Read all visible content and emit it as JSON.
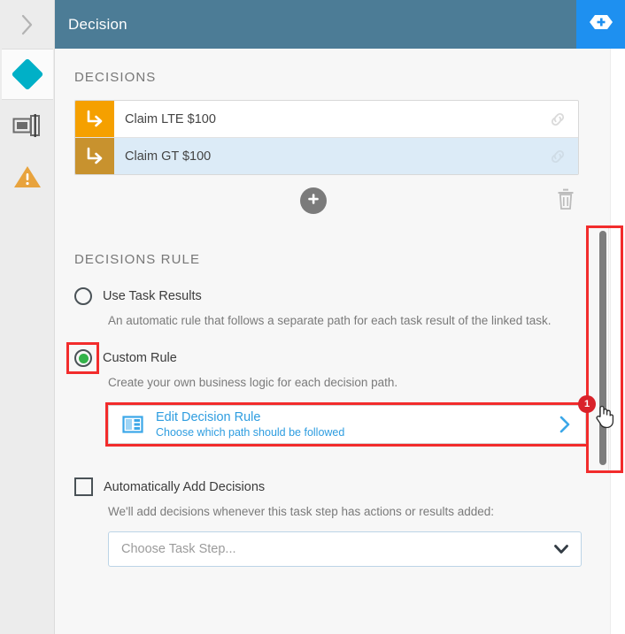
{
  "rail": {
    "expand_icon": "chevron-right-icon",
    "items": [
      {
        "id": "decision",
        "icon": "diamond-icon",
        "active": true
      },
      {
        "id": "form",
        "icon": "form-input-icon",
        "active": false
      },
      {
        "id": "warning",
        "icon": "warning-triangle-icon",
        "active": false
      }
    ]
  },
  "titlebar": {
    "title": "Decision",
    "add_button_icon": "add-hexagon-icon",
    "add_button_color": "#1e90f0",
    "background": "#4c7c96"
  },
  "decisions_section": {
    "heading": "DECISIONS",
    "rows": [
      {
        "label": "Claim LTE $100",
        "icon": "arrow-turn-right-icon",
        "link_icon": "chain-link-icon",
        "selected": false,
        "icon_color": "#f5a000"
      },
      {
        "label": "Claim GT $100",
        "icon": "arrow-turn-right-icon",
        "link_icon": "chain-link-icon",
        "selected": true,
        "icon_color": "#c8922e"
      }
    ],
    "add_icon": "plus-circle-icon",
    "delete_icon": "trash-icon"
  },
  "rule_section": {
    "heading": "DECISIONS RULE",
    "options": [
      {
        "label": "Use Task Results",
        "description": "An automatic rule that follows a separate path for each task result of the linked task.",
        "selected": false
      },
      {
        "label": "Custom Rule",
        "description": "Create your own business logic for each decision path.",
        "selected": true,
        "selected_color": "#33b34a"
      }
    ],
    "edit_rule": {
      "icon": "layout-panels-icon",
      "title": "Edit Decision Rule",
      "subtitle": "Choose which path should be followed",
      "chevron_icon": "chevron-right-icon",
      "badge": "1",
      "badge_color": "#d9222a",
      "link_color": "#2e9de0"
    },
    "auto_add": {
      "label": "Automatically Add Decisions",
      "checked": false,
      "description": "We'll add decisions whenever this task step has actions or results added:",
      "select_placeholder": "Choose Task Step...",
      "select_chevron_icon": "chevron-down-icon"
    }
  },
  "scrollbar": {
    "name": "vertical-scrollbar",
    "thumb_color": "#7c7c7c",
    "cursor_icon": "pointing-hand-cursor"
  },
  "annotations": {
    "highlight_color": "#f22c2c"
  }
}
